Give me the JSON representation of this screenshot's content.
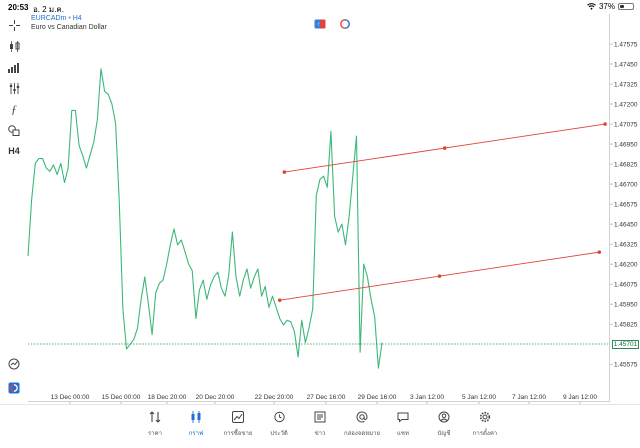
{
  "status_bar": {
    "time": "20:53",
    "date": "อ. 2 ม.ค.",
    "battery": "37%",
    "battery_level": 0.37
  },
  "symbol": {
    "name": "EURCADm",
    "timeframe": "H4",
    "separator": "•",
    "description": "Euro vs Canadian Dollar"
  },
  "toolbar": {
    "timeframe_label": "H4"
  },
  "price_axis": {
    "labels": [
      "1.47575",
      "1.47450",
      "1.47325",
      "1.47200",
      "1.47075",
      "1.46950",
      "1.46825",
      "1.46700",
      "1.46575",
      "1.46450",
      "1.46325",
      "1.46200",
      "1.46075",
      "1.45950",
      "1.45825",
      "1.45575"
    ],
    "current_price": "1.45701"
  },
  "time_axis": {
    "labels": [
      "13 Dec 00:00",
      "15 Dec 00:00",
      "18 Dec 20:00",
      "20 Dec 20:00",
      "22 Dec 20:00",
      "27 Dec 16:00",
      "29 Dec 16:00",
      "3 Jan 12:00",
      "5 Jan 12:00",
      "7 Jan 12:00",
      "9 Jan 12:00"
    ]
  },
  "colors": {
    "price_line": "#3cb878",
    "channel_line": "#e0443a",
    "current_price_line": "#2e8b57",
    "accent": "#1f6fd6"
  },
  "chart_data": {
    "type": "line",
    "symbol": "EURCADm",
    "timeframe": "H4",
    "ylim": [
      1.4552,
      1.4765
    ],
    "y_ticks": [
      1.47575,
      1.4745,
      1.47325,
      1.472,
      1.47075,
      1.4695,
      1.46825,
      1.467,
      1.46575,
      1.4645,
      1.46325,
      1.462,
      1.46075,
      1.4595,
      1.45825,
      1.45575
    ],
    "x_ticks": [
      "13 Dec 00:00",
      "15 Dec 00:00",
      "18 Dec 20:00",
      "20 Dec 20:00",
      "22 Dec 20:00",
      "27 Dec 16:00",
      "29 Dec 16:00",
      "3 Jan 12:00",
      "5 Jan 12:00",
      "7 Jan 12:00",
      "9 Jan 12:00"
    ],
    "series": [
      {
        "values": [
          1.4625,
          1.466,
          1.4683,
          1.4686,
          1.4686,
          1.468,
          1.4678,
          1.4682,
          1.4676,
          1.4683,
          1.4671,
          1.468,
          1.4716,
          1.4716,
          1.4694,
          1.4688,
          1.468,
          1.4688,
          1.4696,
          1.471,
          1.4742,
          1.4728,
          1.4726,
          1.472,
          1.4708,
          1.466,
          1.4592,
          1.4567,
          1.457,
          1.4573,
          1.458,
          1.4598,
          1.4612,
          1.4595,
          1.4576,
          1.4602,
          1.4608,
          1.461,
          1.462,
          1.4632,
          1.4642,
          1.4632,
          1.4635,
          1.4628,
          1.462,
          1.4616,
          1.4586,
          1.4604,
          1.461,
          1.4598,
          1.4607,
          1.4612,
          1.4615,
          1.4605,
          1.46,
          1.4613,
          1.464,
          1.4612,
          1.46,
          1.461,
          1.4617,
          1.4605,
          1.4612,
          1.4617,
          1.46,
          1.4606,
          1.4593,
          1.46,
          1.4593,
          1.4586,
          1.4582,
          1.4585,
          1.4584,
          1.4578,
          1.4562,
          1.4585,
          1.4571,
          1.458,
          1.4592,
          1.4663,
          1.4673,
          1.4675,
          1.4668,
          1.4703,
          1.465,
          1.464,
          1.4645,
          1.4632,
          1.465,
          1.4675,
          1.47,
          1.4565,
          1.462,
          1.4612,
          1.4598,
          1.4587,
          1.4555,
          1.4571
        ],
        "current": 1.45701
      }
    ],
    "channel_lines": [
      {
        "x": [
          0.442,
          0.995
        ],
        "y": [
          1.46775,
          1.47075
        ]
      },
      {
        "x": [
          0.434,
          0.985
        ],
        "y": [
          1.45975,
          1.46275
        ]
      }
    ],
    "grid": false,
    "legend": "none"
  }
}
